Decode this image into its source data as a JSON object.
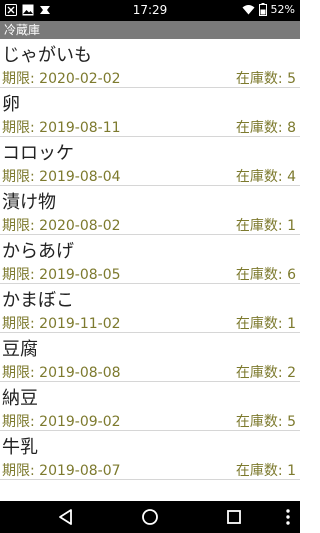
{
  "status_bar": {
    "time": "17:29",
    "battery": "52%",
    "left_icons": [
      "close-box-icon",
      "image-icon",
      "check-arrow-icon"
    ],
    "right_icons": [
      "wifi-icon",
      "battery-icon"
    ]
  },
  "title": "冷蔵庫",
  "items": [
    {
      "name": "じゃがいも",
      "expiry": "期限: 2020-02-02",
      "stock": "在庫数: 5"
    },
    {
      "name": "卵",
      "expiry": "期限: 2019-08-11",
      "stock": "在庫数: 8"
    },
    {
      "name": "コロッケ",
      "expiry": "期限: 2019-08-04",
      "stock": "在庫数: 4"
    },
    {
      "name": "漬け物",
      "expiry": "期限: 2020-08-02",
      "stock": "在庫数: 1"
    },
    {
      "name": "からあげ",
      "expiry": "期限: 2019-08-05",
      "stock": "在庫数: 6"
    },
    {
      "name": "かまぼこ",
      "expiry": "期限: 2019-11-02",
      "stock": "在庫数: 1"
    },
    {
      "name": "豆腐",
      "expiry": "期限: 2019-08-08",
      "stock": "在庫数: 2"
    },
    {
      "name": "納豆",
      "expiry": "期限: 2019-09-02",
      "stock": "在庫数: 5"
    },
    {
      "name": "牛乳",
      "expiry": "期限: 2019-08-07",
      "stock": "在庫数: 1"
    }
  ],
  "nav_bar": {
    "buttons": [
      "back-icon",
      "home-icon",
      "recents-icon",
      "more-icon"
    ]
  },
  "colors": {
    "title_bar": "#7a7a7a",
    "detail_text": "#7d7a2e",
    "divider": "#d6d6d6"
  }
}
